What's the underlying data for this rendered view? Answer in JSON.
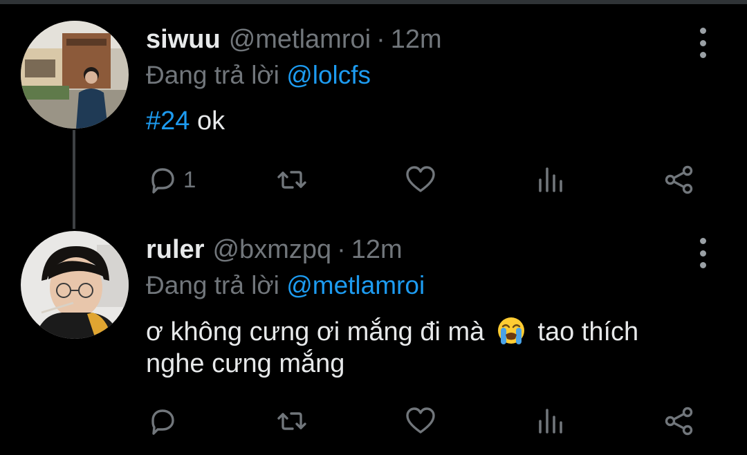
{
  "tweets": [
    {
      "name": "siwuu",
      "handle": "@metlamroi",
      "separator": "·",
      "time": "12m",
      "reply_prefix": "Đang trả lời",
      "reply_to": "@lolcfs",
      "hashtag": "#24",
      "text": "ok",
      "actions": {
        "reply_count": "1"
      }
    },
    {
      "name": "ruler",
      "handle": "@bxmzpq",
      "separator": "·",
      "time": "12m",
      "reply_prefix": "Đang trả lời",
      "reply_to": "@metlamroi",
      "text_line1_a": "ơ không cưng ơi mắng đi mà",
      "emoji": "loudly-crying-face",
      "text_line1_b": "tao thích",
      "text_line2": "nghe cưng mắng",
      "actions": {
        "reply_count": ""
      }
    }
  ],
  "colors": {
    "background": "#000000",
    "text": "#e7e9ea",
    "secondary": "#71767b",
    "accent": "#1d9bf0"
  },
  "icons": [
    "reply-icon",
    "retweet-icon",
    "like-icon",
    "analytics-icon",
    "share-icon",
    "more-icon"
  ]
}
